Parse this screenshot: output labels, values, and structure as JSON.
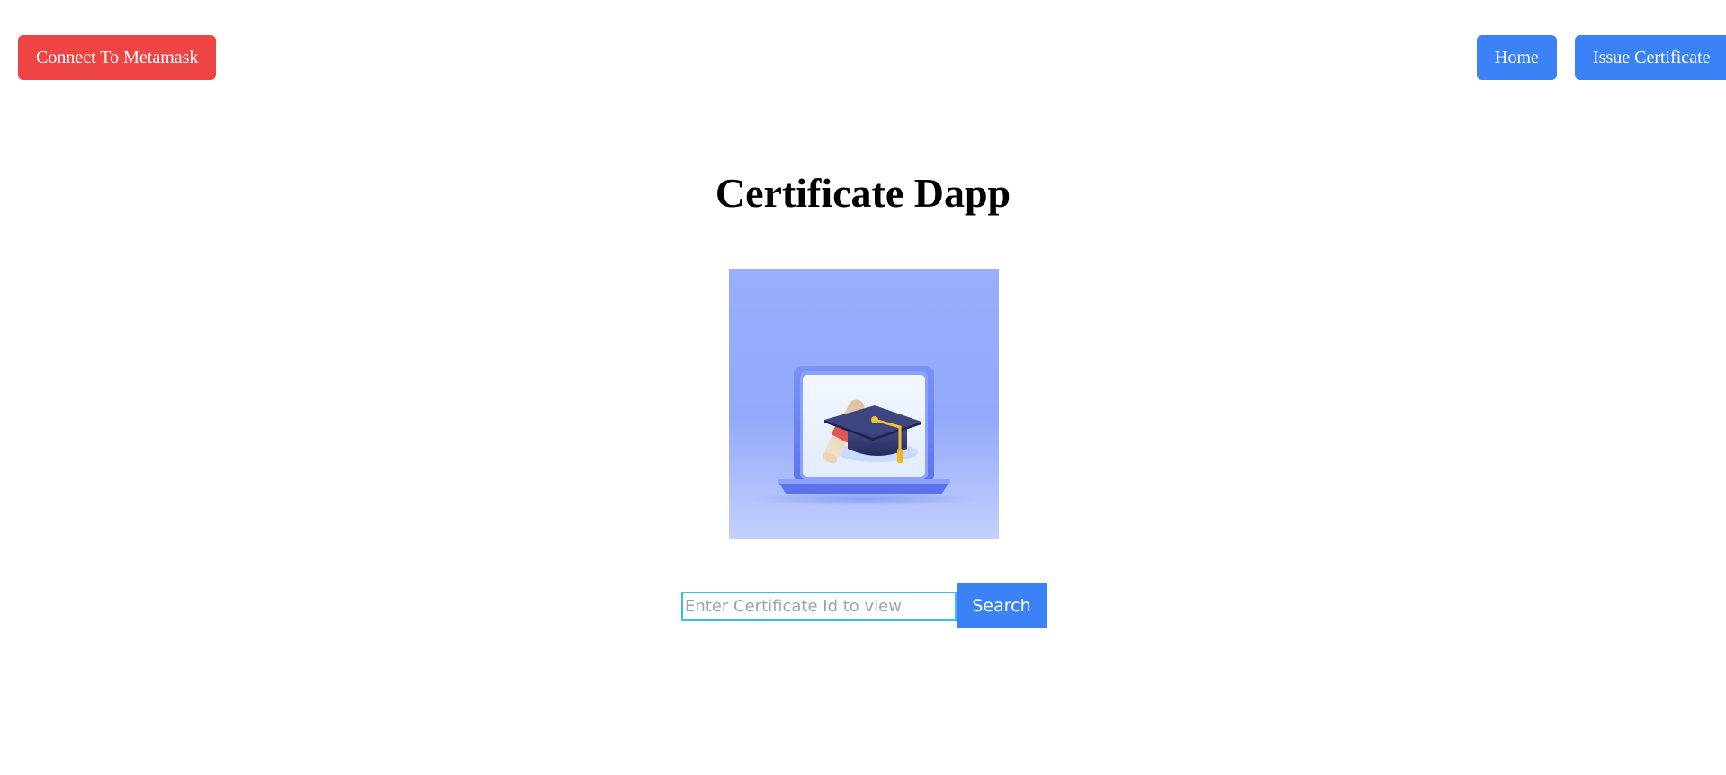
{
  "header": {
    "connect_label": "Connect To Metamask",
    "nav": {
      "home_label": "Home",
      "issue_label": "Issue Certificate"
    }
  },
  "main": {
    "title": "Certificate Dapp",
    "hero_icon": "laptop-graduation-cap-diploma-illustration",
    "search": {
      "placeholder": "Enter Certificate Id to view",
      "value": "",
      "button_label": "Search"
    }
  },
  "colors": {
    "connect_button": "#ef4444",
    "primary_button": "#3b82f6",
    "input_focus_border": "#38bdf8",
    "hero_background": "#9aaefc"
  }
}
